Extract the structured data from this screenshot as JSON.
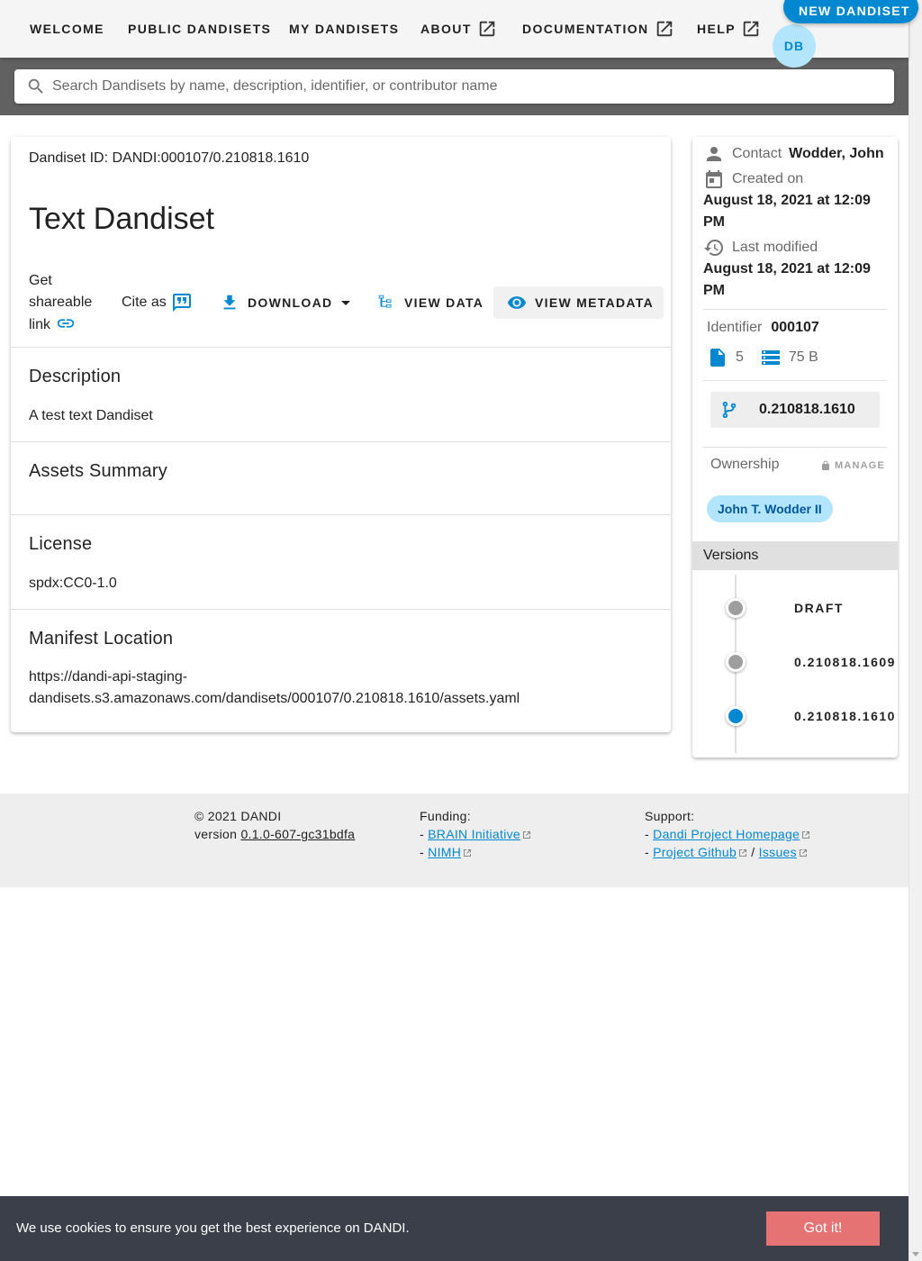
{
  "nav": {
    "items": [
      {
        "label": "WELCOME",
        "external": false
      },
      {
        "label": "PUBLIC DANDISETS",
        "external": false
      },
      {
        "label": "MY DANDISETS",
        "external": false
      },
      {
        "label": "ABOUT",
        "external": true
      },
      {
        "label": "DOCUMENTATION",
        "external": true
      },
      {
        "label": "HELP",
        "external": true
      }
    ],
    "new_dandiset_label": "NEW DANDISET",
    "avatar_initials": "DB"
  },
  "search": {
    "placeholder": "Search Dandisets by name, description, identifier, or contributor name",
    "value": ""
  },
  "dandiset": {
    "id_text": "Dandiset ID: DANDI:000107/0.210818.1610",
    "title": "Text Dandiset",
    "share_label": "Get shareable link",
    "cite_label": "Cite as",
    "actions": {
      "download": "DOWNLOAD",
      "view_data": "VIEW DATA",
      "view_metadata": "VIEW METADATA"
    },
    "sections": {
      "description_title": "Description",
      "description_text": "A test text Dandiset",
      "assets_title": "Assets Summary",
      "license_title": "License",
      "license_text": "spdx:CC0-1.0",
      "manifest_title": "Manifest Location",
      "manifest_text": "https://dandi-api-staging-dandisets.s3.amazonaws.com/dandisets/000107/0.210818.1610/assets.yaml"
    }
  },
  "sidebar": {
    "contact_label": "Contact",
    "contact_value": "Wodder, John",
    "created_label": "Created on",
    "created_value": "August 18, 2021 at 12:09 PM",
    "modified_label": "Last modified",
    "modified_value": "August 18, 2021 at 12:09 PM",
    "identifier_label": "Identifier",
    "identifier_value": "000107",
    "file_count": "5",
    "size": "75 B",
    "current_version": "0.210818.1610",
    "ownership_label": "Ownership",
    "manage_label": "MANAGE",
    "owner": "John T. Wodder II",
    "versions_label": "Versions",
    "versions": [
      {
        "label": "DRAFT",
        "color": "#9e9e9e"
      },
      {
        "label": "0.210818.1609",
        "color": "#9e9e9e"
      },
      {
        "label": "0.210818.1610",
        "color": "#0288d1"
      }
    ]
  },
  "footer": {
    "copyright": "© 2021 DANDI",
    "version_prefix": "version",
    "version_link": "0.1.0-607-gc31bdfa",
    "funding_label": "Funding:",
    "funding_links": [
      "BRAIN Initiative",
      "NIMH"
    ],
    "support_label": "Support:",
    "support_links": [
      "Dandi Project Homepage",
      "Project Github",
      "Issues"
    ]
  },
  "cookie": {
    "message": "We use cookies to ensure you get the best experience on DANDI.",
    "button": "Got it!"
  },
  "colors": {
    "primary": "#0288d1",
    "app_bar": "#f5f5f5",
    "search_strip": "#616161",
    "cookie_bar": "#3a3f49",
    "cookie_button": "#e57373",
    "chip": "#b3e5fc"
  }
}
